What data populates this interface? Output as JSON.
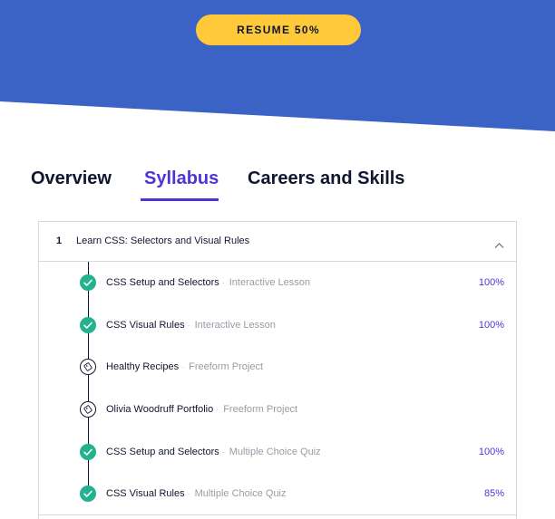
{
  "hero": {
    "resume_label": "RESUME 50%",
    "resume_progress": 0.5,
    "brand_color": "#3a63c5",
    "button_color": "#ffc93a"
  },
  "tabs": [
    {
      "label": "Overview",
      "active": false
    },
    {
      "label": "Syllabus",
      "active": true
    },
    {
      "label": "Careers and Skills",
      "active": false
    }
  ],
  "accent_color": "#4b35d8",
  "syllabus": {
    "section": {
      "number": "1",
      "title": "Learn CSS: Selectors and Visual Rules",
      "expanded": true,
      "toggle_icon": "chevron-up-icon"
    },
    "lessons": [
      {
        "title": "CSS Setup and Selectors",
        "type": "Interactive Lesson",
        "progress": "100%",
        "status": "complete",
        "icon": "check-icon"
      },
      {
        "title": "CSS Visual Rules",
        "type": "Interactive Lesson",
        "progress": "100%",
        "status": "complete",
        "icon": "check-icon"
      },
      {
        "title": "Healthy Recipes",
        "type": "Freeform Project",
        "progress": "",
        "status": "not-started",
        "icon": "project-icon"
      },
      {
        "title": "Olivia Woodruff Portfolio",
        "type": "Freeform Project",
        "progress": "",
        "status": "not-started",
        "icon": "project-icon"
      },
      {
        "title": "CSS Setup and Selectors",
        "type": "Multiple Choice Quiz",
        "progress": "100%",
        "status": "complete",
        "icon": "check-icon"
      },
      {
        "title": "CSS Visual Rules",
        "type": "Multiple Choice Quiz",
        "progress": "85%",
        "status": "complete",
        "icon": "check-icon"
      }
    ]
  }
}
